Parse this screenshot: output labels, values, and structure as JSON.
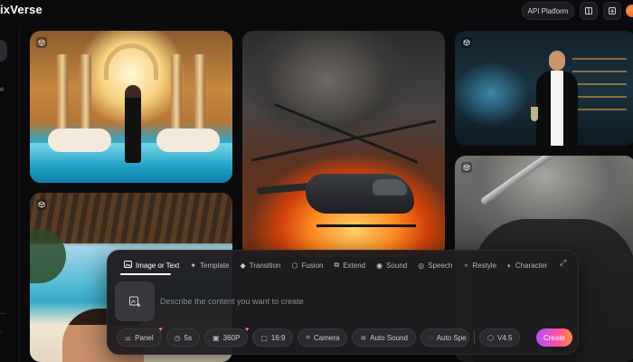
{
  "header": {
    "brand": "ixVerse",
    "api_platform_label": "API Platform",
    "icons": [
      "book-icon",
      "download-icon"
    ]
  },
  "gallery": {
    "cards": [
      {
        "id": "temple",
        "badge_icon": "cube-icon"
      },
      {
        "id": "helicopter",
        "badge_icon": "cube-icon"
      },
      {
        "id": "bar",
        "badge_icon": "cube-icon"
      },
      {
        "id": "beach",
        "badge_icon": "cube-icon"
      },
      {
        "id": "knight",
        "badge_icon": "cube-icon"
      }
    ]
  },
  "composer": {
    "tabs": [
      {
        "label": "Image or Text",
        "icon": "image-icon",
        "active": true
      },
      {
        "label": "Template",
        "icon": "sparkle-icon",
        "active": false
      },
      {
        "label": "Transition",
        "icon": "transition-icon",
        "active": false
      },
      {
        "label": "Fusion",
        "icon": "fusion-icon",
        "active": false
      },
      {
        "label": "Extend",
        "icon": "extend-icon",
        "active": false
      },
      {
        "label": "Sound",
        "icon": "sound-icon",
        "active": false
      },
      {
        "label": "Speech",
        "icon": "speech-icon",
        "active": false
      },
      {
        "label": "Restyle",
        "icon": "restyle-icon",
        "active": false
      },
      {
        "label": "Character",
        "icon": "character-icon",
        "active": false
      }
    ],
    "prompt_placeholder": "Describe the content you want to create",
    "controls": {
      "panel": "Panel",
      "duration": "5s",
      "resolution": "360P",
      "aspect": "16:9",
      "camera": "Camera",
      "auto_sound": "Auto Sound",
      "auto_speech": "Auto Spe",
      "model": "V4.5"
    },
    "create_label": "Create"
  },
  "colors": {
    "background": "#0b0b0d",
    "panel": "#1e1c1e",
    "accent_gradient": [
      "#b451ff",
      "#ff4f9c",
      "#ff8a3d"
    ]
  }
}
